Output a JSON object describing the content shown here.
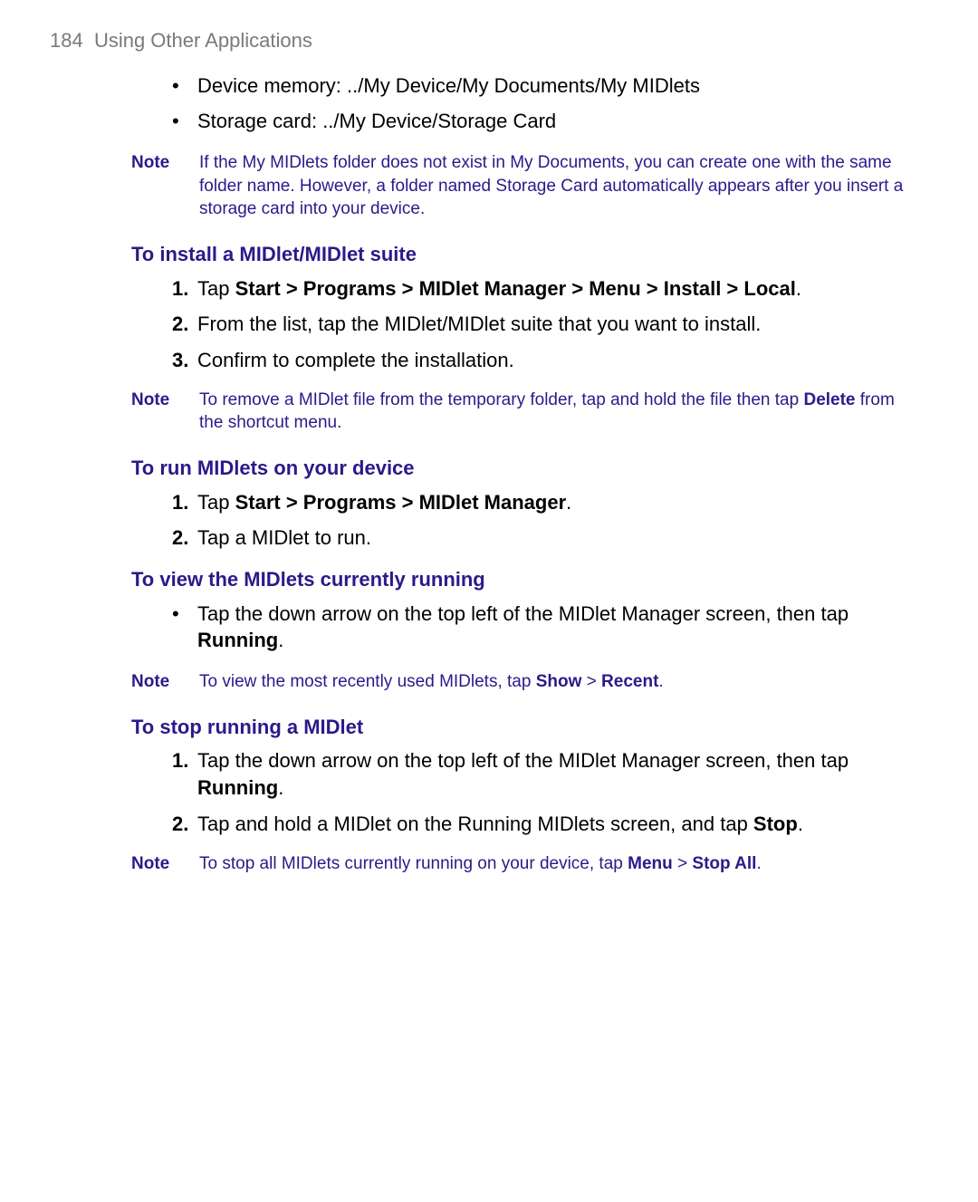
{
  "header": {
    "page_number": "184",
    "title": "Using Other Applications"
  },
  "bullets_top": [
    "Device memory: ../My Device/My Documents/My MIDlets",
    "Storage card: ../My Device/Storage Card"
  ],
  "note1": {
    "label": "Note",
    "text": "If the My MIDlets folder does not exist in My Documents, you can create one with the same folder name. However, a folder named Storage Card automatically appears after you insert a storage card into your device."
  },
  "section1": {
    "heading": "To install a MIDlet/MIDlet suite",
    "steps": {
      "s1_marker": "1.",
      "s1_pre": "Tap ",
      "s1_bold": "Start > Programs > MIDlet Manager > Menu > Install > Local",
      "s1_post": ".",
      "s2_marker": "2.",
      "s2_text": "From the list, tap the MIDlet/MIDlet suite that you want to install.",
      "s3_marker": "3.",
      "s3_text": "Confirm to complete the installation."
    }
  },
  "note2": {
    "label": "Note",
    "pre": "To remove a MIDlet file from the temporary folder, tap and hold the file then tap ",
    "bold": "Delete",
    "post": " from the shortcut menu."
  },
  "section2": {
    "heading": "To run MIDlets on your device",
    "steps": {
      "s1_marker": "1.",
      "s1_pre": "Tap ",
      "s1_bold": "Start > Programs > MIDlet Manager",
      "s1_post": ".",
      "s2_marker": "2.",
      "s2_text": "Tap a MIDlet to run."
    }
  },
  "section3": {
    "heading": "To view the MIDlets currently running",
    "bullet": {
      "pre": "Tap the down arrow on the top left of the MIDlet Manager screen, then tap ",
      "bold": "Running",
      "post": "."
    }
  },
  "note3": {
    "label": "Note",
    "pre": "To view the most recently used MIDlets, tap ",
    "bold1": "Show",
    "mid": " > ",
    "bold2": "Recent",
    "post": "."
  },
  "section4": {
    "heading": "To stop running a MIDlet",
    "steps": {
      "s1_marker": "1.",
      "s1_pre": "Tap the down arrow on the top left of the MIDlet Manager screen, then tap ",
      "s1_bold": "Running",
      "s1_post": ".",
      "s2_marker": "2.",
      "s2_pre": "Tap and hold a MIDlet on the Running MIDlets screen, and tap ",
      "s2_bold": "Stop",
      "s2_post": "."
    }
  },
  "note4": {
    "label": "Note",
    "pre": "To stop all MIDlets currently running on your device, tap ",
    "bold1": "Menu",
    "mid": " > ",
    "bold2": "Stop All",
    "post": "."
  }
}
